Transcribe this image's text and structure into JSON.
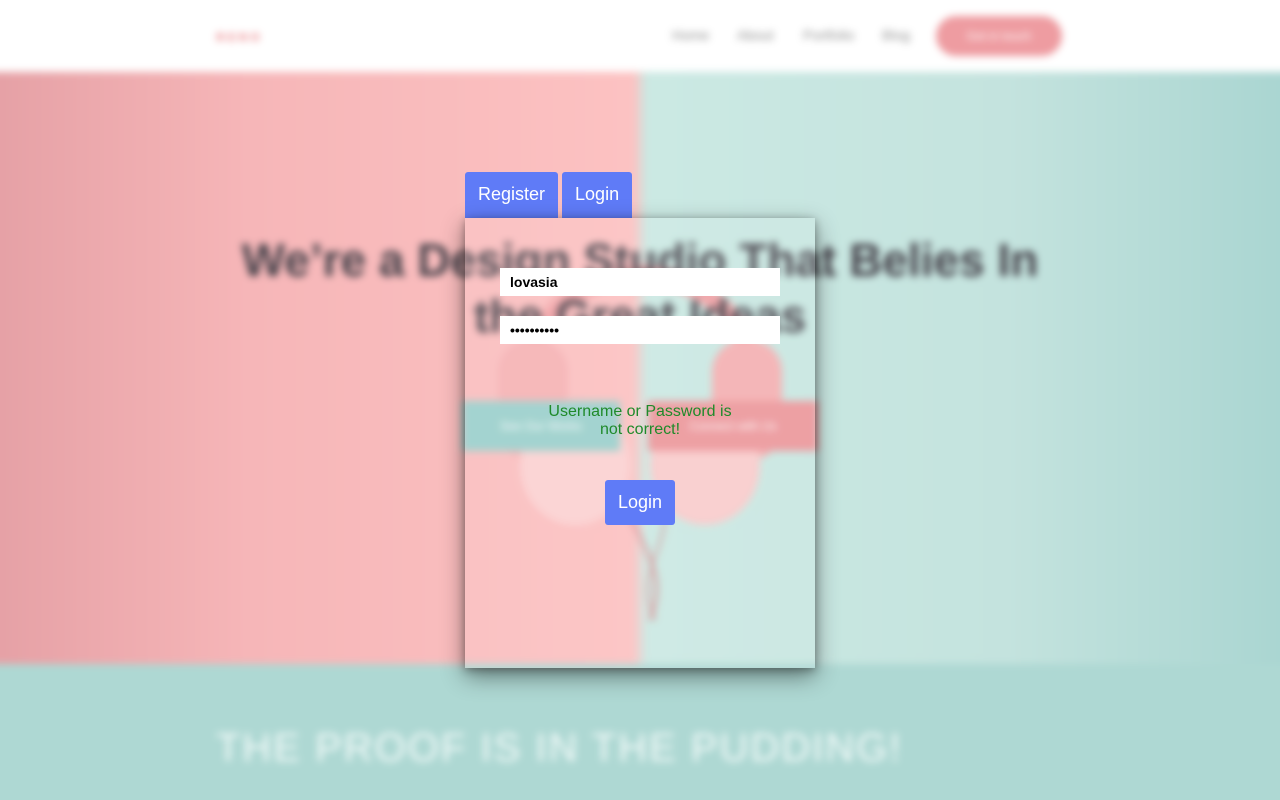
{
  "background_site": {
    "logo": "ʀᴇɴᴏ",
    "nav": [
      "Home",
      "About",
      "Portfolio",
      "Blog"
    ],
    "cta": "Get in touch",
    "headline": "We’re a Design Studio That Belies In the Great Ideas",
    "hero_buttons": [
      "See Our Works",
      "Connect with Us"
    ],
    "section_title": "THE PROOF IS IN THE PUDDING!"
  },
  "modal": {
    "tabs": [
      "Register",
      "Login"
    ],
    "active_tab": "Login",
    "username_value": "lovasia",
    "password_value": "••••••••••",
    "error_message": "Username or Password is not correct!",
    "submit_label": "Login"
  },
  "colors": {
    "button_blue": "#5f7bf7",
    "error_green": "#1f8a2a",
    "hero_pink": "#fcc2c2",
    "hero_teal": "#cbe9e3",
    "brand_pink": "#ec8b8f"
  },
  "icons": [
    "headphones-image"
  ]
}
